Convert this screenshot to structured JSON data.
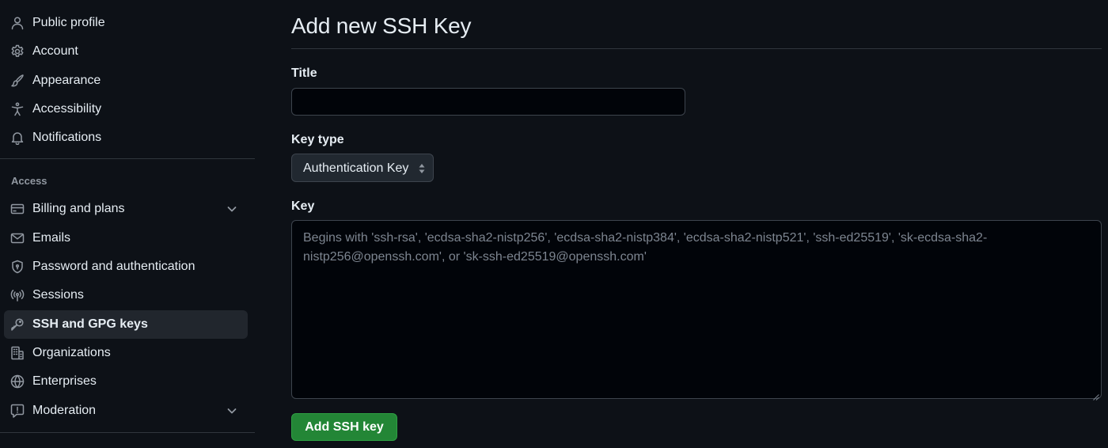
{
  "sidebar": {
    "items": [
      {
        "label": "Public profile",
        "icon": "person-icon"
      },
      {
        "label": "Account",
        "icon": "gear-icon"
      },
      {
        "label": "Appearance",
        "icon": "paintbrush-icon"
      },
      {
        "label": "Accessibility",
        "icon": "accessibility-icon"
      },
      {
        "label": "Notifications",
        "icon": "bell-icon"
      }
    ],
    "access_heading": "Access",
    "access_items": [
      {
        "label": "Billing and plans",
        "icon": "credit-card-icon",
        "expandable": true
      },
      {
        "label": "Emails",
        "icon": "mail-icon"
      },
      {
        "label": "Password and authentication",
        "icon": "shield-lock-icon"
      },
      {
        "label": "Sessions",
        "icon": "broadcast-icon"
      },
      {
        "label": "SSH and GPG keys",
        "icon": "key-icon",
        "active": true
      },
      {
        "label": "Organizations",
        "icon": "organization-icon"
      },
      {
        "label": "Enterprises",
        "icon": "globe-icon"
      },
      {
        "label": "Moderation",
        "icon": "report-icon",
        "expandable": true
      }
    ]
  },
  "main": {
    "title": "Add new SSH Key",
    "title_field": {
      "label": "Title",
      "value": "",
      "placeholder": ""
    },
    "key_type": {
      "label": "Key type",
      "selected": "Authentication Key"
    },
    "key_field": {
      "label": "Key",
      "value": "",
      "placeholder": "Begins with 'ssh-rsa', 'ecdsa-sha2-nistp256', 'ecdsa-sha2-nistp384', 'ecdsa-sha2-nistp521', 'ssh-ed25519', 'sk-ecdsa-sha2-nistp256@openssh.com', or 'sk-ssh-ed25519@openssh.com'"
    },
    "submit_label": "Add SSH key"
  },
  "colors": {
    "background": "#0d1117",
    "active_item_bg": "#21262d",
    "primary_button": "#238636",
    "border": "#30363d"
  }
}
